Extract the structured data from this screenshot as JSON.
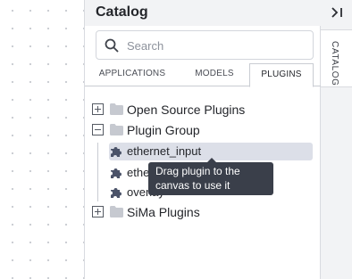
{
  "panel": {
    "title": "Catalog",
    "search_placeholder": "Search",
    "tabs": [
      "APPLICATIONS",
      "MODELS",
      "PLUGINS"
    ],
    "active_tab": "PLUGINS"
  },
  "rail": {
    "tab_label": "CATALOG"
  },
  "tree": {
    "groups": [
      {
        "label": "Open Source Plugins",
        "expanded": false
      },
      {
        "label": "Plugin Group",
        "expanded": true,
        "items": [
          "ethernet_input",
          "ethe",
          "overlay"
        ]
      },
      {
        "label": "SiMa Plugins",
        "expanded": false
      }
    ]
  },
  "tooltip": {
    "text": "Drag plugin to the canvas to use it"
  },
  "colors": {
    "selected_row": "#dcdfe8",
    "tooltip_bg": "#3a3f4a",
    "folder": "#c6c9d0",
    "puzzle": "#4b5369"
  }
}
